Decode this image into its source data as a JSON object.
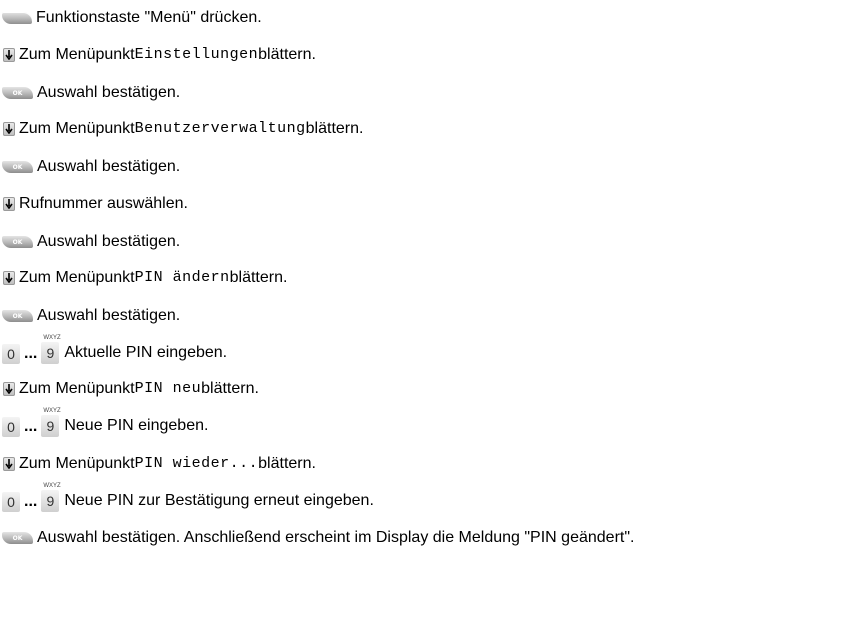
{
  "steps": {
    "s1": {
      "text": "Funktionstaste \"Menü\" drücken."
    },
    "s2": {
      "pre": "Zum Menüpunkt ",
      "code": "Einstellungen",
      "post": " blättern."
    },
    "s3": {
      "text": "Auswahl bestätigen."
    },
    "s4": {
      "pre": "Zum Menüpunkt ",
      "code": "Benutzerverwaltung",
      "post": " blättern."
    },
    "s5": {
      "text": "Auswahl bestätigen."
    },
    "s6": {
      "text": "Rufnummer auswählen."
    },
    "s7": {
      "text": "Auswahl bestätigen."
    },
    "s8": {
      "pre": "Zum Menüpunkt ",
      "code": "PIN ändern",
      "post": " blättern."
    },
    "s9": {
      "text": "Auswahl bestätigen."
    },
    "s10": {
      "text": "Aktuelle PIN eingeben."
    },
    "s11": {
      "pre": "Zum Menüpunkt ",
      "code": "PIN neu",
      "post": " blättern."
    },
    "s12": {
      "text": "Neue PIN eingeben."
    },
    "s13": {
      "pre": "Zum Menüpunkt ",
      "code": "PIN wieder...",
      "post": " blättern."
    },
    "s14": {
      "text": "Neue PIN zur Bestätigung erneut eingeben."
    },
    "s15": {
      "text": "Auswahl bestätigen. Anschließend erscheint im Display die Meldung \"PIN geändert\"."
    }
  },
  "keys": {
    "ok_label": "OK",
    "digit_first": "0",
    "digit_last": "9",
    "digit_last_letters": "WXYZ",
    "ellipsis": "..."
  },
  "icons": {
    "menu": "softkey-icon",
    "down": "arrow-down-key-icon",
    "ok": "ok-key-icon",
    "digits": "digit-keys-icon"
  }
}
